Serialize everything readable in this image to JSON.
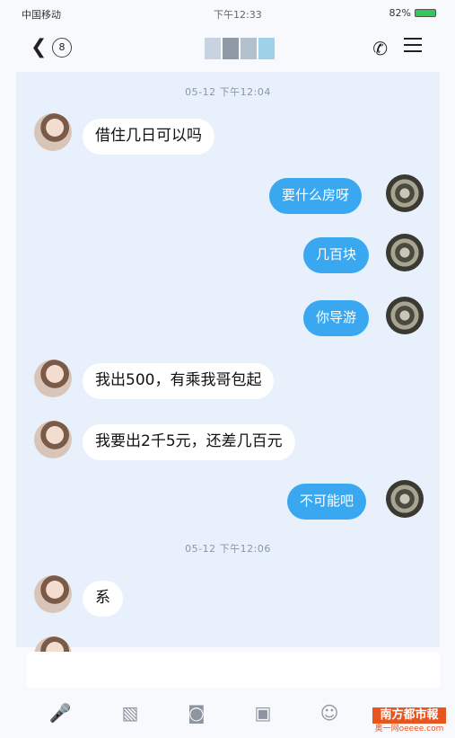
{
  "status_bar": {
    "carrier": "中国移动",
    "time": "下午12:33",
    "battery": "82%"
  },
  "header": {
    "back_badge": "8"
  },
  "conversation": [
    {
      "type": "time",
      "text": "05-12 下午12:04"
    },
    {
      "type": "msg",
      "from": "them",
      "text": "借住几日可以吗"
    },
    {
      "type": "msg",
      "from": "me",
      "text": "要什么房呀"
    },
    {
      "type": "msg",
      "from": "me",
      "text": "几百块"
    },
    {
      "type": "msg",
      "from": "me",
      "text": "你导游"
    },
    {
      "type": "msg",
      "from": "them",
      "text": "我出500，有乘我哥包起"
    },
    {
      "type": "msg",
      "from": "them",
      "text": "我要出2千5元，还差几百元"
    },
    {
      "type": "msg",
      "from": "me",
      "text": "不可能吧"
    },
    {
      "type": "time",
      "text": "05-12 下午12:06"
    },
    {
      "type": "msg",
      "from": "them",
      "text": "系"
    }
  ],
  "watermark": {
    "title": "南方都市報",
    "subtitle": "奥一网oeeee.com"
  },
  "colors": {
    "chat_bg": "#e8f1fb",
    "bubble_out": "#3aa8f0",
    "bubble_in": "#ffffff"
  },
  "icons": [
    "microphone-icon",
    "image-icon",
    "camera-icon",
    "red-packet-icon",
    "emoji-icon",
    "more-icon"
  ]
}
